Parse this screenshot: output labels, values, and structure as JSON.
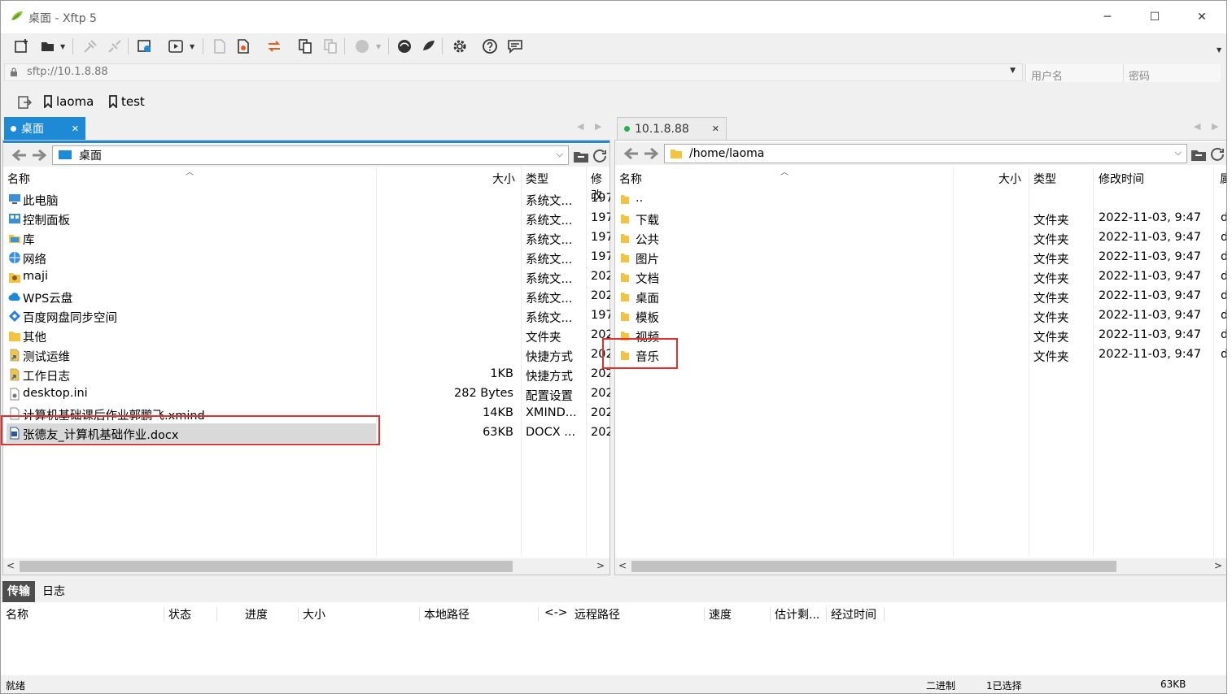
{
  "window": {
    "title": "桌面 - Xftp 5",
    "minimize_glyph": "─",
    "maximize_glyph": "☐",
    "close_glyph": "✕"
  },
  "toolbar": {
    "items": [
      {
        "icon": "new-session-icon",
        "enabled": true
      },
      {
        "icon": "open-folder-icon",
        "enabled": true,
        "dropdown": true
      },
      {
        "icon": "connect-icon",
        "enabled": false
      },
      {
        "icon": "disconnect-icon",
        "enabled": false
      },
      {
        "icon": "session-properties-icon",
        "enabled": true
      },
      {
        "icon": "transfer-queue-icon",
        "enabled": true,
        "dropdown": true
      },
      {
        "icon": "new-file-icon",
        "enabled": false
      },
      {
        "icon": "text-file-icon",
        "enabled": true
      },
      {
        "icon": "sync-icon",
        "enabled": true
      },
      {
        "icon": "copy-icon",
        "enabled": true
      },
      {
        "icon": "paste-icon",
        "enabled": false
      },
      {
        "icon": "globe-icon",
        "enabled": false,
        "dropdown": true
      },
      {
        "icon": "xshell-icon",
        "enabled": true
      },
      {
        "icon": "xmanager-icon",
        "enabled": true
      },
      {
        "icon": "gear-icon",
        "enabled": true
      },
      {
        "icon": "help-icon",
        "enabled": true
      },
      {
        "icon": "chat-icon",
        "enabled": true
      }
    ]
  },
  "address": {
    "url": "sftp://10.1.8.88",
    "username_placeholder": "用户名",
    "password_placeholder": "密码"
  },
  "bookmarks": [
    {
      "label": "laoma"
    },
    {
      "label": "test"
    }
  ],
  "local_panel": {
    "tab_label": "桌面",
    "path": "桌面",
    "columns": {
      "name": "名称",
      "size": "大小",
      "type": "类型",
      "modified": "修改"
    },
    "files": [
      {
        "name": "此电脑",
        "size": "",
        "type": "系统文...",
        "modified": "197",
        "icon": "computer-icon"
      },
      {
        "name": "控制面板",
        "size": "",
        "type": "系统文...",
        "modified": "197",
        "icon": "control-panel-icon"
      },
      {
        "name": "库",
        "size": "",
        "type": "系统文...",
        "modified": "197",
        "icon": "library-icon"
      },
      {
        "name": "网络",
        "size": "",
        "type": "系统文...",
        "modified": "197",
        "icon": "network-icon"
      },
      {
        "name": "maji",
        "size": "",
        "type": "系统文...",
        "modified": "202",
        "icon": "user-folder-icon"
      },
      {
        "name": "WPS云盘",
        "size": "",
        "type": "系统文...",
        "modified": "202",
        "icon": "cloud-icon"
      },
      {
        "name": "百度网盘同步空间",
        "size": "",
        "type": "系统文...",
        "modified": "197",
        "icon": "baidu-sync-icon"
      },
      {
        "name": "其他",
        "size": "",
        "type": "文件夹",
        "modified": "202",
        "icon": "folder-icon"
      },
      {
        "name": "测试运维",
        "size": "",
        "type": "快捷方式",
        "modified": "202",
        "icon": "shortcut-icon"
      },
      {
        "name": "工作日志",
        "size": "1KB",
        "type": "快捷方式",
        "modified": "202",
        "icon": "shortcut-icon"
      },
      {
        "name": "desktop.ini",
        "size": "282 Bytes",
        "type": "配置设置",
        "modified": "202",
        "icon": "settings-file-icon"
      },
      {
        "name": "计算机基础课后作业郭鹏飞.xmind",
        "size": "14KB",
        "type": "XMIND...",
        "modified": "202",
        "icon": "file-icon"
      },
      {
        "name": "张德友_计算机基础作业.docx",
        "size": "63KB",
        "type": "DOCX ...",
        "modified": "202",
        "icon": "docx-icon",
        "selected": true
      }
    ]
  },
  "remote_panel": {
    "tab_label": "10.1.8.88",
    "path": "/home/laoma",
    "columns": {
      "name": "名称",
      "size": "大小",
      "type": "类型",
      "modified": "修改时间",
      "perm": "属"
    },
    "files": [
      {
        "name": "..",
        "type": "",
        "modified": "",
        "perm": ""
      },
      {
        "name": "下载",
        "type": "文件夹",
        "modified": "2022-11-03, 9:47",
        "perm": "d"
      },
      {
        "name": "公共",
        "type": "文件夹",
        "modified": "2022-11-03, 9:47",
        "perm": "d"
      },
      {
        "name": "图片",
        "type": "文件夹",
        "modified": "2022-11-03, 9:47",
        "perm": "d"
      },
      {
        "name": "文档",
        "type": "文件夹",
        "modified": "2022-11-03, 9:47",
        "perm": "d"
      },
      {
        "name": "桌面",
        "type": "文件夹",
        "modified": "2022-11-03, 9:47",
        "perm": "d"
      },
      {
        "name": "模板",
        "type": "文件夹",
        "modified": "2022-11-03, 9:47",
        "perm": "dr"
      },
      {
        "name": "视频",
        "type": "文件夹",
        "modified": "2022-11-03, 9:47",
        "perm": "d"
      },
      {
        "name": "音乐",
        "type": "文件夹",
        "modified": "2022-11-03, 9:47",
        "perm": "d"
      }
    ]
  },
  "transfer": {
    "tabs": [
      "传输",
      "日志"
    ],
    "columns": [
      "名称",
      "状态",
      "进度",
      "大小",
      "本地路径",
      "<->",
      "远程路径",
      "速度",
      "估计剩...",
      "经过时间"
    ]
  },
  "status": {
    "left": "就绪",
    "mode": "二进制",
    "selection": "1已选择",
    "size": "63KB"
  },
  "colors": {
    "accent": "#1e8ad6",
    "highlight": "#e03030",
    "connected": "#22b14c",
    "folder": "#f5c342"
  }
}
